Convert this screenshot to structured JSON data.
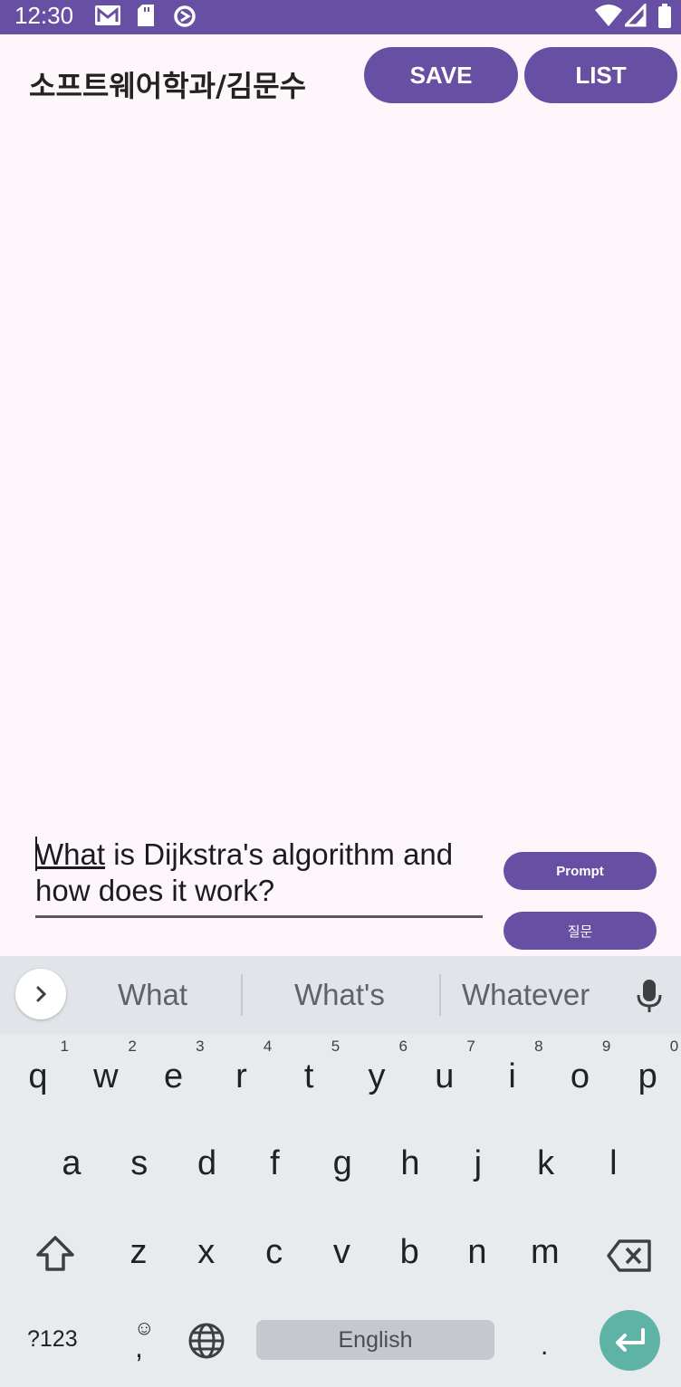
{
  "status_bar": {
    "time": "12:30",
    "left_icons": [
      "gmail-icon",
      "sd-card-icon",
      "data-saver-icon"
    ],
    "right_icons": [
      "wifi-icon",
      "signal-icon",
      "battery-icon"
    ],
    "background": "#6750a4"
  },
  "header": {
    "title": "소프트웨어학과/김문수",
    "save_label": "SAVE",
    "list_label": "LIST"
  },
  "prompt": {
    "value_first_word": "What",
    "value_rest_line1": " is Dijkstra's algorithm and",
    "value_line2": "how does it work?",
    "prompt_button_label": "Prompt",
    "ask_button_label": "질문"
  },
  "keyboard": {
    "suggestions": [
      "What",
      "What's",
      "Whatever"
    ],
    "row1": [
      {
        "k": "q",
        "h": "1"
      },
      {
        "k": "w",
        "h": "2"
      },
      {
        "k": "e",
        "h": "3"
      },
      {
        "k": "r",
        "h": "4"
      },
      {
        "k": "t",
        "h": "5"
      },
      {
        "k": "y",
        "h": "6"
      },
      {
        "k": "u",
        "h": "7"
      },
      {
        "k": "i",
        "h": "8"
      },
      {
        "k": "o",
        "h": "9"
      },
      {
        "k": "p",
        "h": "0"
      }
    ],
    "row2": [
      "a",
      "s",
      "d",
      "f",
      "g",
      "h",
      "j",
      "k",
      "l"
    ],
    "row3": [
      "z",
      "x",
      "c",
      "v",
      "b",
      "n",
      "m"
    ],
    "symbols_label": "?123",
    "comma_label": ",",
    "period_label": ".",
    "space_label": "English",
    "accent_color": "#5fb3a6"
  }
}
